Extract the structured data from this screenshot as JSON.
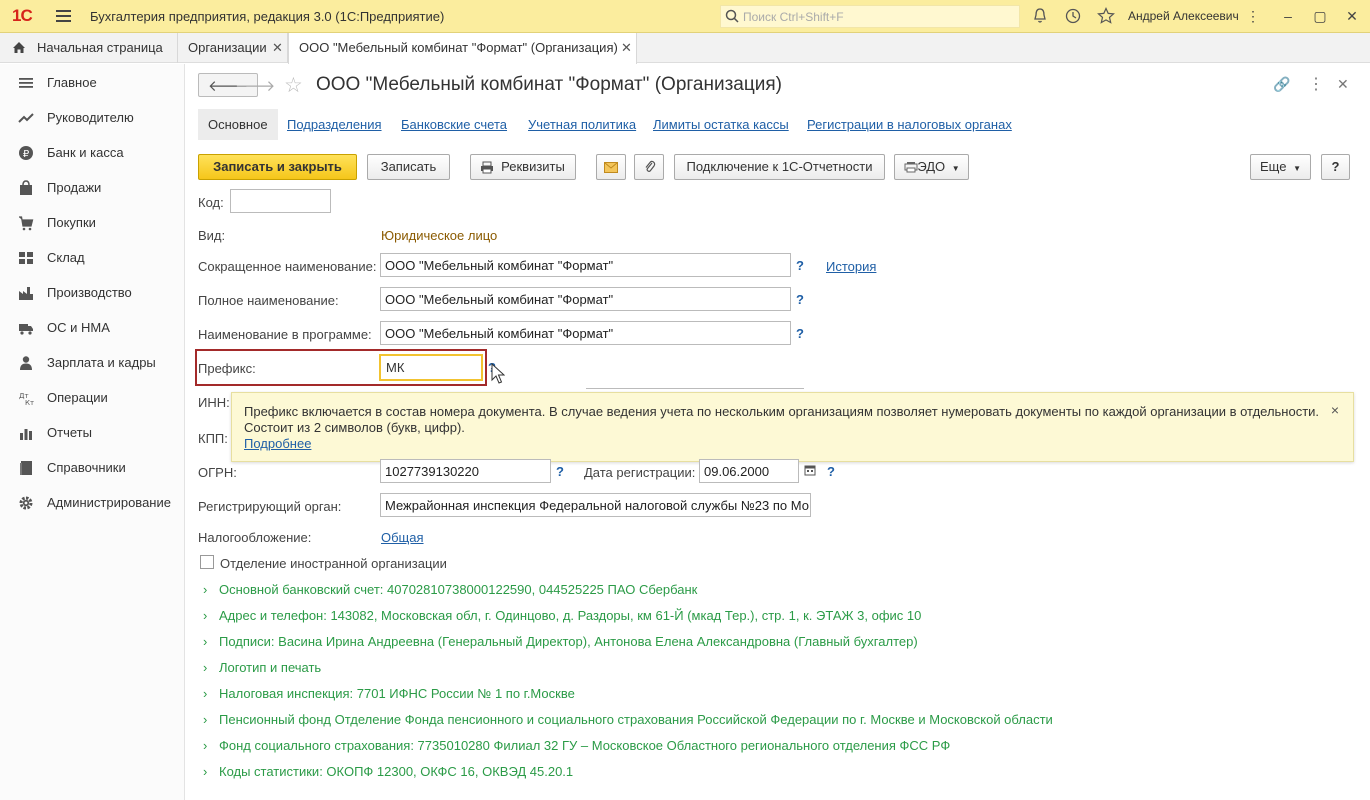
{
  "app": {
    "logo": "1С",
    "title": "Бухгалтерия предприятия, редакция 3.0  (1С:Предприятие)",
    "search_placeholder": "Поиск Ctrl+Shift+F",
    "user": "Андрей Алексеевич"
  },
  "tabs": [
    {
      "label": "Начальная страница"
    },
    {
      "label": "Организации"
    },
    {
      "label": "ООО \"Мебельный комбинат \"Формат\" (Организация)"
    }
  ],
  "sidebar": {
    "items": [
      {
        "label": "Главное",
        "icon": "menu-icon"
      },
      {
        "label": "Руководителю",
        "icon": "trend-icon"
      },
      {
        "label": "Банк и касса",
        "icon": "ruble-icon"
      },
      {
        "label": "Продажи",
        "icon": "bag-icon"
      },
      {
        "label": "Покупки",
        "icon": "cart-icon"
      },
      {
        "label": "Склад",
        "icon": "warehouse-icon"
      },
      {
        "label": "Производство",
        "icon": "factory-icon"
      },
      {
        "label": "ОС и НМА",
        "icon": "truck-icon"
      },
      {
        "label": "Зарплата и кадры",
        "icon": "person-icon"
      },
      {
        "label": "Операции",
        "icon": "dt-kt-icon"
      },
      {
        "label": "Отчеты",
        "icon": "chart-icon"
      },
      {
        "label": "Справочники",
        "icon": "book-icon"
      },
      {
        "label": "Администрирование",
        "icon": "gear-icon"
      }
    ]
  },
  "form": {
    "title": "ООО \"Мебельный комбинат \"Формат\" (Организация)",
    "subtabs": [
      "Основное",
      "Подразделения",
      "Банковские счета",
      "Учетная политика",
      "Лимиты остатка кассы",
      "Регистрации в налоговых органах"
    ],
    "toolbar": {
      "save_close": "Записать и закрыть",
      "save": "Записать",
      "requisites": "Реквизиты",
      "connect": "Подключение к 1С-Отчетности",
      "edo": "ЭДО",
      "more": "Еще",
      "help": "?"
    },
    "fields": {
      "code_label": "Код:",
      "code_value": "",
      "kind_label": "Вид:",
      "kind_value": "Юридическое лицо",
      "short_name_label": "Сокращенное наименование:",
      "short_name_value": "ООО \"Мебельный комбинат \"Формат\"",
      "history": "История",
      "full_name_label": "Полное наименование:",
      "full_name_value": "ООО \"Мебельный комбинат \"Формат\"",
      "program_name_label": "Наименование в программе:",
      "program_name_value": "ООО \"Мебельный комбинат \"Формат\"",
      "prefix_label": "Префикс:",
      "prefix_value": "МК",
      "inn_label": "ИНН:",
      "kpp_label": "КПП:",
      "ogrn_label": "ОГРН:",
      "ogrn_value": "1027739130220",
      "reg_date_label": "Дата регистрации:",
      "reg_date_value": "09.06.2000",
      "reg_body_label": "Регистрирующий орган:",
      "reg_body_value": "Межрайонная инспекция Федеральной налоговой службы №23 по Мо",
      "tax_label": "Налогообложение:",
      "tax_value": "Общая",
      "foreign_branch": "Отделение иностранной организации",
      "q": "?"
    },
    "tooltip": {
      "line1": "Префикс включается в состав номера документа. В случае ведения учета по нескольким организациям позволяет нумеровать документы по каждой организации в отдельности.",
      "line2": "Состоит из 2 символов (букв, цифр).",
      "more": "Подробнее",
      "close": "×"
    },
    "groups": [
      "Основной банковский счет: 40702810738000122590, 044525225 ПАО Сбербанк",
      "Адрес и телефон: 143082, Московская обл, г. Одинцово, д. Раздоры, км 61-Й (мкад Тер.), стр. 1, к. ЭТАЖ 3, офис 10",
      "Подписи: Васина Ирина Андреевна (Генеральный Директор), Антонова Елена Александровна (Главный бухгалтер)",
      "Логотип и печать",
      "Налоговая инспекция: 7701 ИФНС России № 1 по г.Москве",
      "Пенсионный фонд Отделение Фонда пенсионного и социального страхования Российской Федерации по г. Москве и Московской области",
      "Фонд социального страхования: 7735010280 Филиал 32 ГУ – Московское Областного регионального отделения ФСС РФ",
      "Коды статистики: ОКОПФ 12300, ОКФС 16, ОКВЭД 45.20.1"
    ]
  },
  "colors": {
    "topbar": "#fbed9e",
    "primary_button": "#f5c61a",
    "link": "#1f5fa6",
    "group_text": "#2b9b47",
    "highlight_frame": "#a32a2a"
  }
}
